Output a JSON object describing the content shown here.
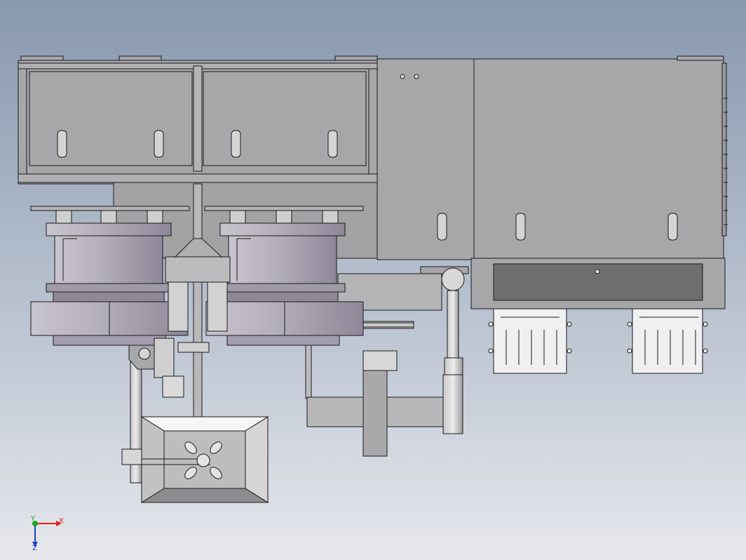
{
  "viewport": {
    "background_top": "#8898ae",
    "background_bottom": "#e6e8ec"
  },
  "model": {
    "body_color": "#a7a7a9",
    "panel_color": "#a5a5a7",
    "line_color": "#1a1a1a",
    "bowl_color": "#a59fab",
    "drawer_color": "#6e6e70"
  },
  "triad": {
    "x_label": "X",
    "y_label": "Y",
    "z_label": "Z",
    "x_color": "#e02020",
    "y_color": "#20a020",
    "z_color": "#2040d0"
  }
}
